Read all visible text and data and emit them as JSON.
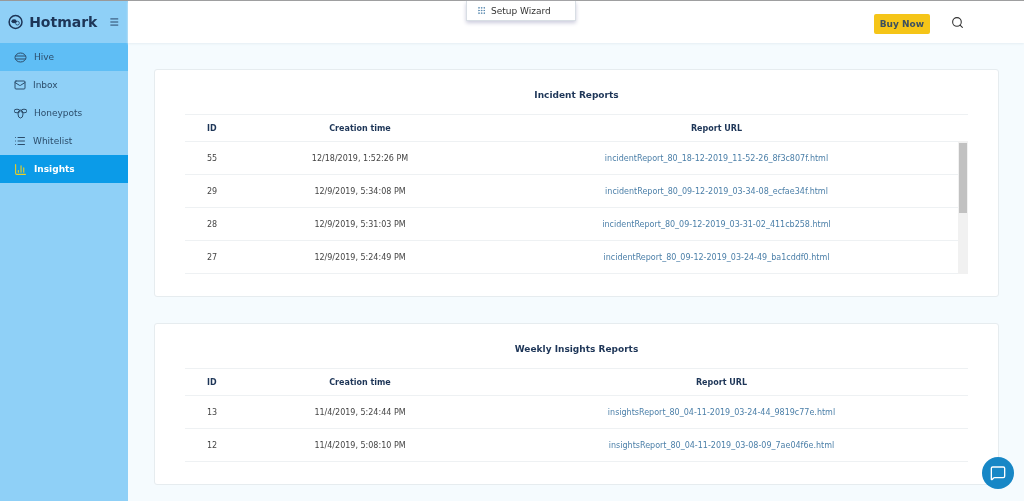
{
  "brand": {
    "name": "Hotmark"
  },
  "sidebar": {
    "items": [
      {
        "label": "Hive",
        "selected": false,
        "hovered": true
      },
      {
        "label": "Inbox",
        "selected": false,
        "hovered": false
      },
      {
        "label": "Honeypots",
        "selected": false,
        "hovered": false
      },
      {
        "label": "Whitelist",
        "selected": false,
        "hovered": false
      },
      {
        "label": "Insights",
        "selected": true,
        "hovered": false
      }
    ]
  },
  "topbar": {
    "wizard": "Setup Wizard",
    "buy_button": "Buy Now"
  },
  "cards": [
    {
      "title": "Incident Reports",
      "scrollable": true,
      "columns": [
        "ID",
        "Creation time",
        "Report URL"
      ],
      "rows": [
        [
          "55",
          "12/18/2019, 1:52:26 PM",
          "incidentReport_80_18-12-2019_11-52-26_8f3c807f.html"
        ],
        [
          "29",
          "12/9/2019, 5:34:08 PM",
          "incidentReport_80_09-12-2019_03-34-08_ecfae34f.html"
        ],
        [
          "28",
          "12/9/2019, 5:31:03 PM",
          "incidentReport_80_09-12-2019_03-31-02_411cb258.html"
        ],
        [
          "27",
          "12/9/2019, 5:24:49 PM",
          "incidentReport_80_09-12-2019_03-24-49_ba1cddf0.html"
        ]
      ]
    },
    {
      "title": "Weekly Insights Reports",
      "scrollable": false,
      "columns": [
        "ID",
        "Creation time",
        "Report URL"
      ],
      "rows": [
        [
          "13",
          "11/4/2019, 5:24:44 PM",
          "insightsReport_80_04-11-2019_03-24-44_9819c77e.html"
        ],
        [
          "12",
          "11/4/2019, 5:08:10 PM",
          "insightsReport_80_04-11-2019_03-08-09_7ae04f6e.html"
        ]
      ]
    }
  ]
}
